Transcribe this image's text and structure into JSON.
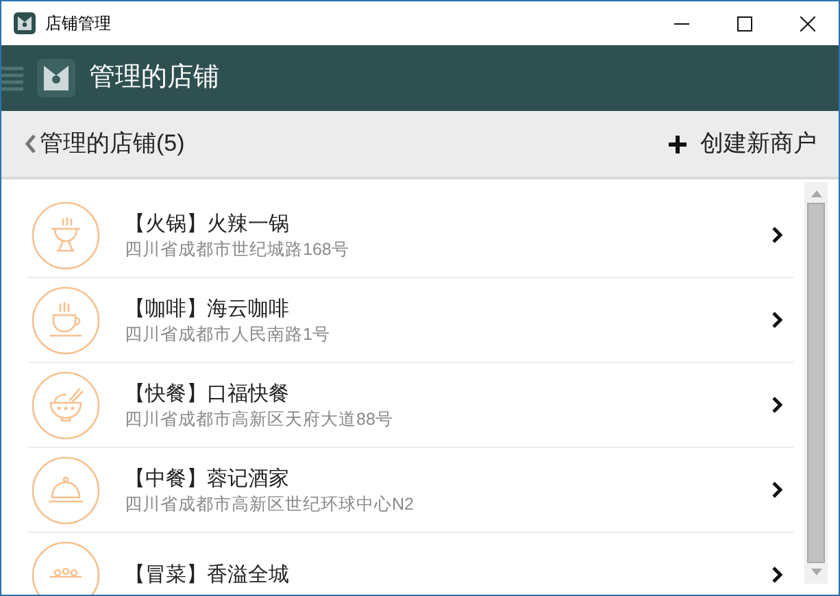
{
  "window": {
    "title": "店铺管理"
  },
  "header": {
    "title": "管理的店铺"
  },
  "toolbar": {
    "back_label": "管理的店铺(5)",
    "create_label": "创建新商户"
  },
  "stores": [
    {
      "kind": "hotpot",
      "title": "【火锅】火辣一锅",
      "address": "四川省成都市世纪城路168号"
    },
    {
      "kind": "coffee",
      "title": "【咖啡】海云咖啡",
      "address": "四川省成都市人民南路1号"
    },
    {
      "kind": "fastfood",
      "title": "【快餐】口福快餐",
      "address": "四川省成都市高新区天府大道88号"
    },
    {
      "kind": "chinese",
      "title": "【中餐】蓉记酒家",
      "address": "四川省成都市高新区世纪环球中心N2"
    },
    {
      "kind": "maocai",
      "title": "【冒菜】香溢全城"
    }
  ]
}
